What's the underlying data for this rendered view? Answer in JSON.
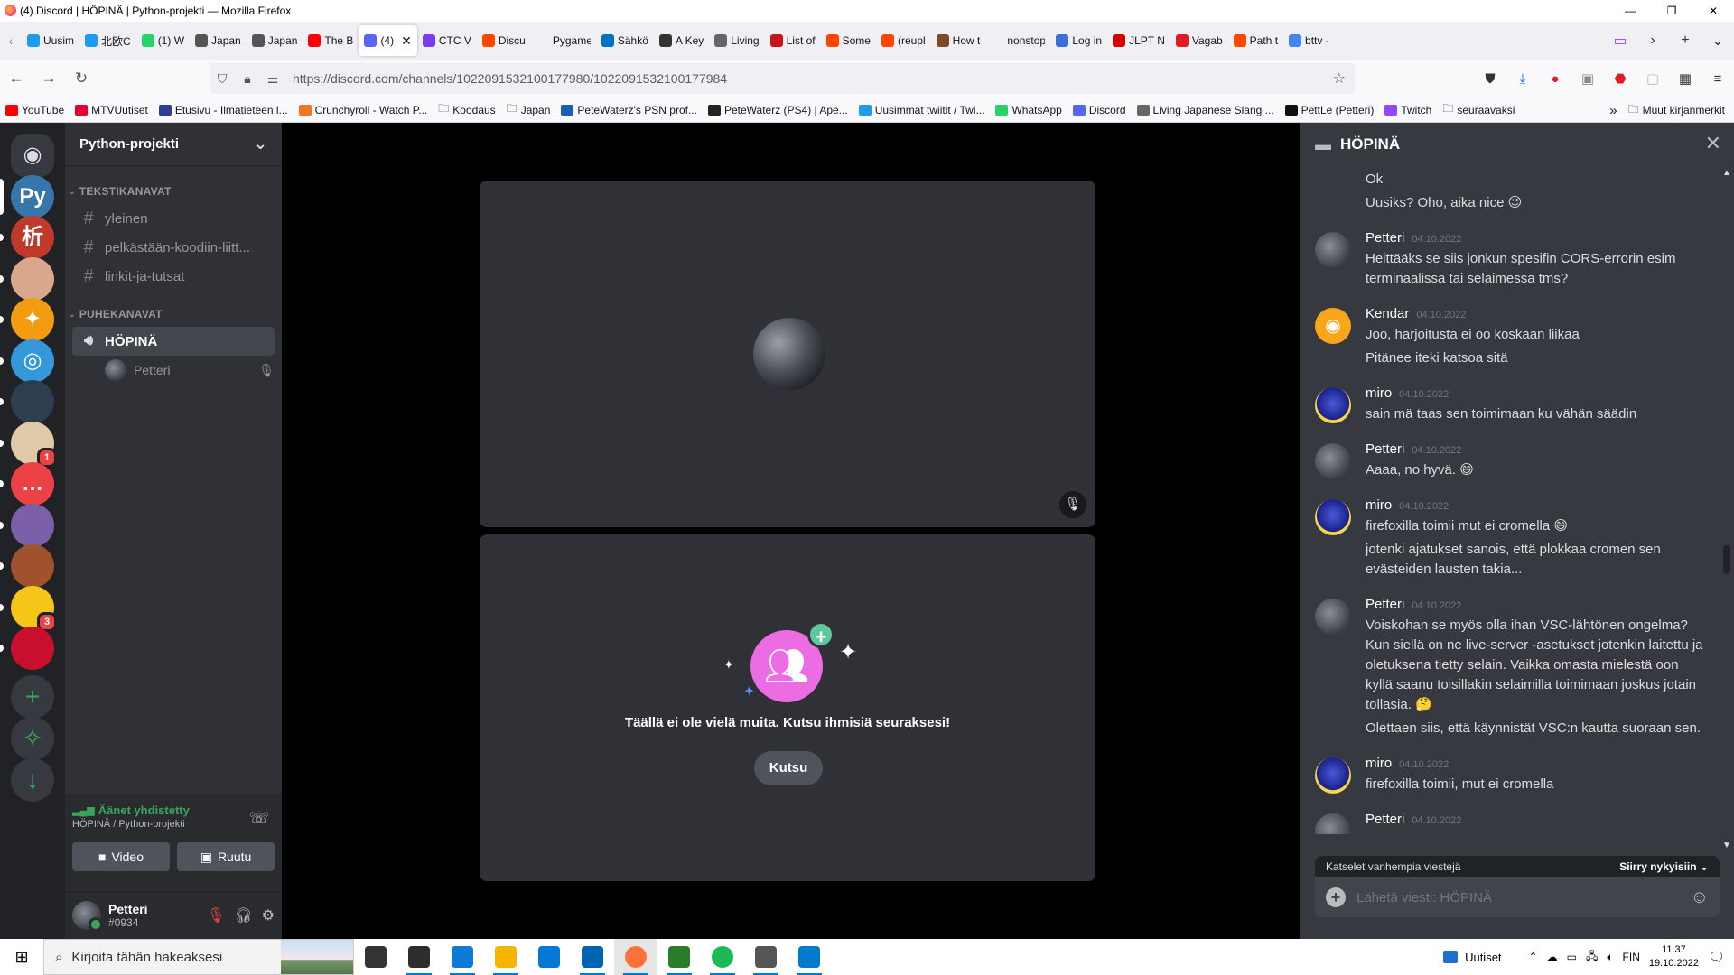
{
  "window": {
    "title": "(4) Discord | HÖPINÄ | Python-projekti — Mozilla Firefox",
    "controls": [
      "—",
      "❐",
      "✕"
    ]
  },
  "tabs": [
    {
      "label": "Uusim",
      "color": "#1d9bf0"
    },
    {
      "label": "北欧C",
      "color": "#1d9bf0"
    },
    {
      "label": "(1) W",
      "color": "#25d366"
    },
    {
      "label": "Japan",
      "color": "#555555"
    },
    {
      "label": "Japan",
      "color": "#555555"
    },
    {
      "label": "The B",
      "color": "#ff0000"
    },
    {
      "label": "(4)",
      "color": "#5865f2",
      "active": true
    },
    {
      "label": "CTC V",
      "color": "#7a3cf0"
    },
    {
      "label": "Discu",
      "color": "#ff4500"
    },
    {
      "label": "Pygame k",
      "color": "#f0f0f4"
    },
    {
      "label": "Sähkö",
      "color": "#0072c6"
    },
    {
      "label": "A Key",
      "color": "#333333"
    },
    {
      "label": "Living",
      "color": "#666666"
    },
    {
      "label": "List of",
      "color": "#c4161c"
    },
    {
      "label": "Some",
      "color": "#ff4500"
    },
    {
      "label": "(reupl",
      "color": "#ff4500"
    },
    {
      "label": "How t",
      "color": "#7a4a2a"
    },
    {
      "label": "nonstop_l",
      "color": "#f0f0f4"
    },
    {
      "label": "Log in",
      "color": "#3b6fd8"
    },
    {
      "label": "JLPT N",
      "color": "#d40000"
    },
    {
      "label": "Vagab",
      "color": "#e01b24"
    },
    {
      "label": "Path t",
      "color": "#ff4500"
    },
    {
      "label": "bttv -",
      "color": "#4285f4"
    }
  ],
  "tab_active_close": "✕",
  "tabbar_controls": {
    "purple_icon": "▭",
    "more": "›",
    "new_tab": "+",
    "list": "⌄"
  },
  "nav": {
    "back": "←",
    "forward": "→",
    "reload": "↻",
    "url": "https://discord.com/channels/1022091532100177980/1022091532100177984",
    "star": "☆"
  },
  "bookmarks": [
    {
      "label": "YouTube",
      "color": "#ff0000"
    },
    {
      "label": "MTVUutiset",
      "color": "#e4002b"
    },
    {
      "label": "Etusivu - Ilmatieteen l...",
      "color": "#2c3e91"
    },
    {
      "label": "Crunchyroll - Watch P...",
      "color": "#f47521"
    },
    {
      "label": "Koodaus",
      "color": "folder"
    },
    {
      "label": "Japan",
      "color": "folder"
    },
    {
      "label": "PeteWaterz's PSN prof...",
      "color": "#1a5fb4"
    },
    {
      "label": "PeteWaterz (PS4) | Ape...",
      "color": "#222222"
    },
    {
      "label": "Uusimmat twiitit / Twi...",
      "color": "#1d9bf0"
    },
    {
      "label": "WhatsApp",
      "color": "#25d366"
    },
    {
      "label": "Discord",
      "color": "#5865f2"
    },
    {
      "label": "Living Japanese Slang ...",
      "color": "#666666"
    },
    {
      "label": "PettLe (Petteri)",
      "color": "#111111"
    },
    {
      "label": "Twitch",
      "color": "#9146ff"
    },
    {
      "label": "seuraavaksi",
      "color": "folder"
    }
  ],
  "bookmarks_more": "»",
  "bookmarks_other": "Muut kirjanmerkit",
  "guilds": [
    {
      "icon": "discord-home-icon",
      "color": "#36393f",
      "glyph": "◉"
    },
    {
      "icon": "python-icon",
      "color": "#3776ab",
      "glyph": "Py",
      "selected": true
    },
    {
      "icon": "kanji-icon",
      "color": "#c0392b",
      "glyph": "析"
    },
    {
      "icon": "server-icon",
      "color": "#d9a88c",
      "glyph": ""
    },
    {
      "icon": "server-icon",
      "color": "#f39c12",
      "glyph": "✦"
    },
    {
      "icon": "server-icon",
      "color": "#3498db",
      "glyph": "◎"
    },
    {
      "icon": "server-icon",
      "color": "#2c3e50",
      "glyph": ""
    },
    {
      "icon": "server-icon",
      "color": "#e0c9a6",
      "glyph": "",
      "badge": "1"
    },
    {
      "icon": "server-icon",
      "color": "#ed4245",
      "glyph": "…"
    },
    {
      "icon": "server-icon",
      "color": "#7b5fa8",
      "glyph": ""
    },
    {
      "icon": "server-icon",
      "color": "#a0522d",
      "glyph": ""
    },
    {
      "icon": "server-icon",
      "color": "#f5c518",
      "glyph": "",
      "badge": "3"
    },
    {
      "icon": "server-icon",
      "color": "#c8102e",
      "glyph": ""
    }
  ],
  "guild_actions": {
    "add": "+",
    "explore": "✧",
    "download": "↓"
  },
  "server": {
    "name": "Python-projekti",
    "chevron": "⌄",
    "text_category": "TEKSTIKANAVAT",
    "text_channels": [
      "yleinen",
      "pelkästään-koodiin-liitt...",
      "linkit-ja-tutsat"
    ],
    "voice_category": "PUHEKANAVAT",
    "voice_channel": "HÖPINÄ",
    "voice_members": [
      {
        "name": "Petteri"
      }
    ]
  },
  "voice_panel": {
    "status": "Äänet yhdistetty",
    "location": "HÖPINÄ / Python-projekti",
    "video_label": "Video",
    "screen_label": "Ruutu"
  },
  "user": {
    "name": "Petteri",
    "tag": "#0934"
  },
  "stage": {
    "invite_text": "Täällä ei ole vielä muita. Kutsu ihmisiä seuraksesi!",
    "invite_button": "Kutsu"
  },
  "chat": {
    "title": "HÖPINÄ",
    "close": "✕",
    "messages": [
      {
        "author": "",
        "time": "",
        "avatar": "none",
        "lines": [
          "Ok",
          "Uusiks? Oho, aika nice 😉"
        ]
      },
      {
        "author": "Petteri",
        "time": "04.10.2022",
        "avatar": "petteri",
        "lines": [
          "Heittääks se siis jonkun spesifin CORS-errorin esim terminaalissa tai selaimessa tms?"
        ]
      },
      {
        "author": "Kendar",
        "time": "04.10.2022",
        "avatar": "kendar",
        "lines": [
          "Joo, harjoitusta ei oo koskaan liikaa",
          "Pitänee iteki katsoa sitä"
        ]
      },
      {
        "author": "miro",
        "time": "04.10.2022",
        "avatar": "miro",
        "lines": [
          "sain mä taas sen toimimaan ku vähän säädin"
        ]
      },
      {
        "author": "Petteri",
        "time": "04.10.2022",
        "avatar": "petteri",
        "lines": [
          "Aaaa, no hyvä. 😄"
        ]
      },
      {
        "author": "miro",
        "time": "04.10.2022",
        "avatar": "miro",
        "lines": [
          "firefoxilla toimii mut ei cromella 😄",
          "jotenki ajatukset sanois, että plokkaa cromen sen evästeiden lausten takia..."
        ]
      },
      {
        "author": "Petteri",
        "time": "04.10.2022",
        "avatar": "petteri",
        "lines": [
          "Voiskohan se myös olla ihan VSC-lähtönen ongelma? Kun siellä on ne live-server -asetukset jotenkin laitettu ja oletuksena tietty selain. Vaikka omasta mielestä oon kyllä saanu toisillakin selaimilla toimimaan joskus jotain tollasia. 🤔",
          "Olettaen siis, että käynnistät VSC:n kautta suoraan sen."
        ]
      },
      {
        "author": "miro",
        "time": "04.10.2022",
        "avatar": "miro",
        "lines": [
          "firefoxilla toimii, mut ei cromella"
        ]
      },
      {
        "author": "Petteri",
        "time": "04.10.2022",
        "avatar": "petteri",
        "lines": [
          ""
        ]
      }
    ],
    "older_notice": "Katselet vanhempia viestejä",
    "jump_label": "Siirry nykyisiin",
    "input_placeholder": "Lähetä viesti: HÖPINÄ"
  },
  "taskbar": {
    "search_placeholder": "Kirjoita tähän hakeaksesi",
    "apps": [
      {
        "name": "task-view",
        "color": "#333333"
      },
      {
        "name": "terminal",
        "color": "#2d2d2d"
      },
      {
        "name": "edge",
        "color": "#0f7bd7"
      },
      {
        "name": "file-explorer",
        "color": "#f4b400"
      },
      {
        "name": "store",
        "color": "#0078d4"
      },
      {
        "name": "mail",
        "color": "#0063b1"
      },
      {
        "name": "firefox",
        "color": "#ff7139",
        "active": true
      },
      {
        "name": "vpn",
        "color": "#2a7b2a"
      },
      {
        "name": "spotify",
        "color": "#1db954"
      },
      {
        "name": "media-app",
        "color": "#555555"
      },
      {
        "name": "vscode",
        "color": "#007acc"
      }
    ],
    "news_label": "Uutiset",
    "language": "FIN",
    "time": "11.37",
    "date": "19.10.2022"
  },
  "colors": {
    "accent_green": "#3ba55d",
    "danger_red": "#ed4245",
    "discord_blurple": "#5865f2"
  }
}
